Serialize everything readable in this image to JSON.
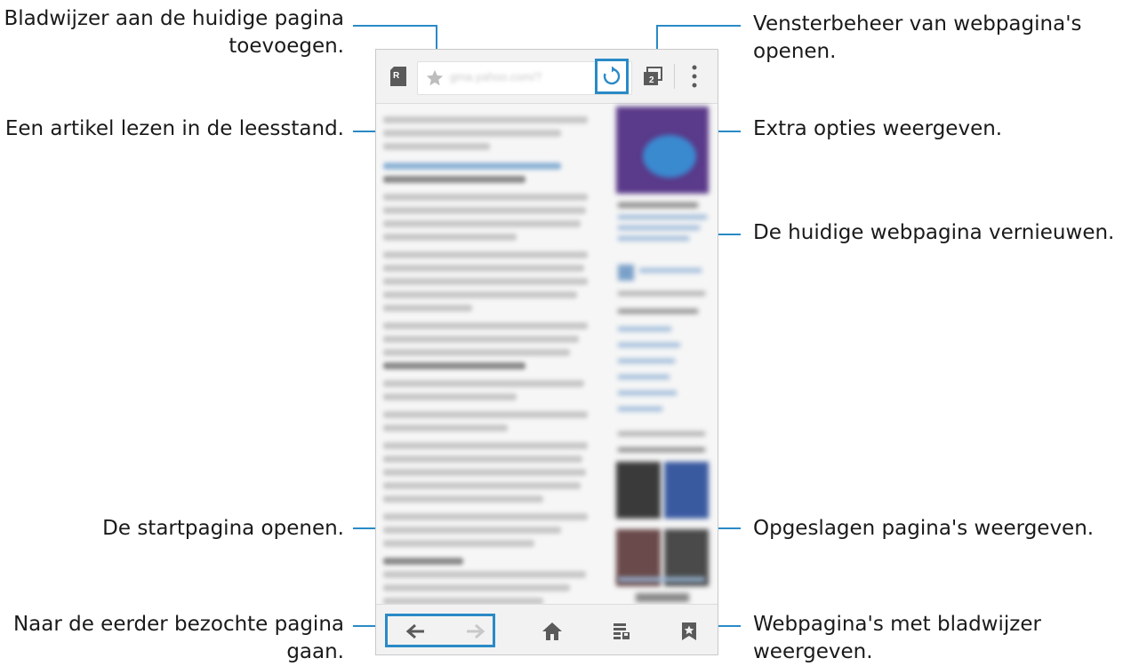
{
  "annotations": {
    "bookmark_add_line1": "Bladwijzer aan de huidige pagina",
    "bookmark_add_line2": "toevoegen.",
    "reader_mode": "Een artikel lezen in de leesstand.",
    "window_manager_line1": "Vensterbeheer van webpagina's",
    "window_manager_line2": "openen.",
    "more_options": "Extra opties weergeven.",
    "refresh": "De huidige webpagina vernieuwen.",
    "home": "De startpagina openen.",
    "saved_pages": "Opgeslagen pagina's weergeven.",
    "back_line1": "Naar de eerder bezochte pagina",
    "back_line2": "gaan.",
    "bookmarks_line1": "Webpagina's met bladwijzer",
    "bookmarks_line2": "weergeven."
  },
  "browser": {
    "reader_badge": "R",
    "url_text": "gma.yahoo.com/?",
    "window_count": "2"
  },
  "icons": {
    "reader": "reader-mode-icon",
    "star": "star-icon",
    "refresh": "refresh-icon",
    "windows": "window-manager-icon",
    "menu": "more-options-icon",
    "back": "back-arrow-icon",
    "forward": "forward-arrow-icon",
    "home": "home-icon",
    "saved": "saved-pages-icon",
    "bookmarks": "bookmarks-icon"
  },
  "colors": {
    "accent": "#2a8ac6",
    "icon": "#5a5a5a",
    "disabled_icon": "#c8c8c8"
  }
}
